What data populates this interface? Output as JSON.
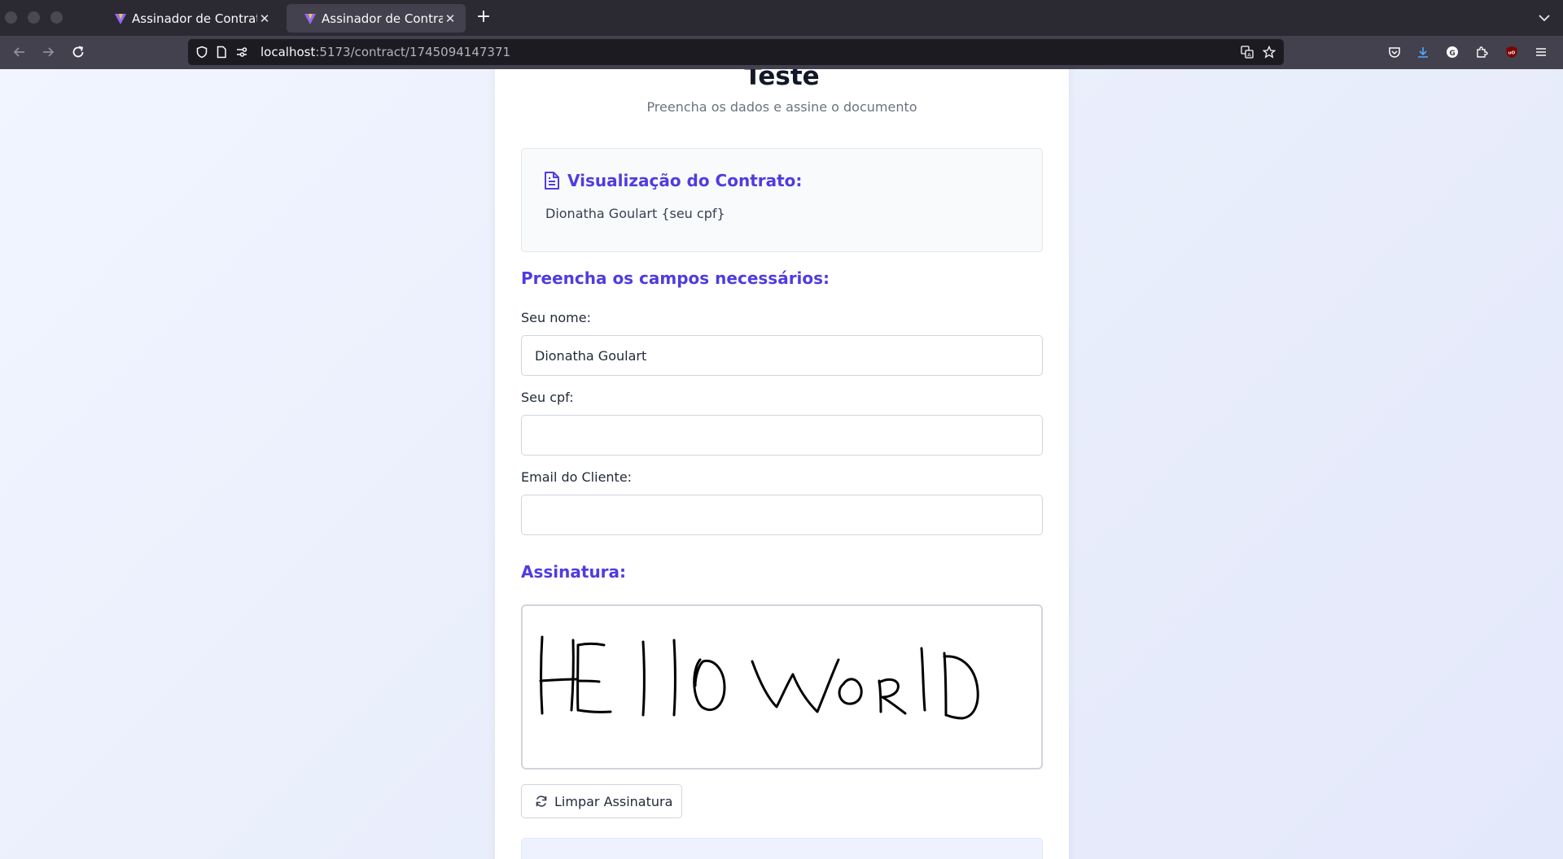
{
  "browser": {
    "tabs": [
      {
        "title": "Assinador de Contratos",
        "active": false
      },
      {
        "title": "Assinador de Contratos",
        "active": true
      }
    ],
    "url_host": "localhost",
    "url_path": ":5173/contract/1745094147371"
  },
  "page": {
    "title": "Teste",
    "subtitle": "Preencha os dados e assine o documento"
  },
  "preview": {
    "title": "Visualização do Contrato:",
    "body": "Dionatha Goulart {seu cpf}"
  },
  "form": {
    "section_title": "Preencha os campos necessários:",
    "fields": [
      {
        "label": "Seu nome:",
        "value": "Dionatha Goulart"
      },
      {
        "label": "Seu cpf:",
        "value": ""
      },
      {
        "label": "Email do Cliente:",
        "value": ""
      }
    ]
  },
  "signature": {
    "section_title": "Assinatura:",
    "clear_label": "Limpar Assinatura"
  },
  "colors": {
    "accent": "#4f3ce0",
    "chrome_dark": "#2b2a33",
    "chrome_mid": "#42414d"
  }
}
